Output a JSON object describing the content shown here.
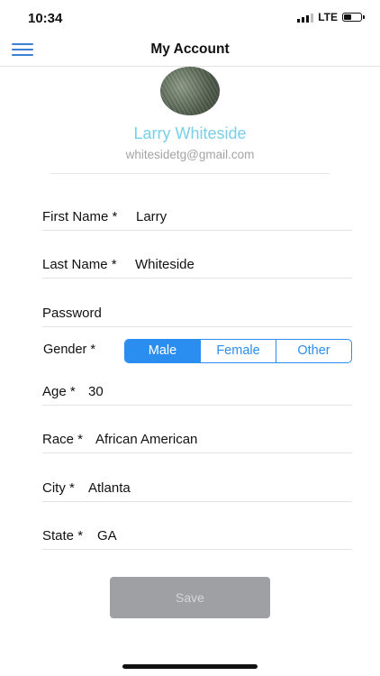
{
  "status_bar": {
    "time": "10:34",
    "network": "LTE"
  },
  "header": {
    "title": "My Account"
  },
  "profile": {
    "name": "Larry Whiteside",
    "email": "whitesidetg@gmail.com"
  },
  "fields": {
    "first_name": {
      "label": "First Name *",
      "value": "Larry"
    },
    "last_name": {
      "label": "Last Name *",
      "value": "Whiteside"
    },
    "password": {
      "label": "Password",
      "value": ""
    },
    "age": {
      "label": "Age *",
      "value": "30"
    },
    "race": {
      "label": "Race *",
      "value": "African American"
    },
    "city": {
      "label": "City *",
      "value": "Atlanta"
    },
    "state": {
      "label": "State *",
      "value": "GA"
    }
  },
  "gender": {
    "label": "Gender *",
    "options": [
      "Male",
      "Female",
      "Other"
    ],
    "selected": "Male"
  },
  "save_label": "Save",
  "colors": {
    "accent": "#2a8ef0",
    "name": "#79cfe8",
    "save_bg": "#9ea0a3"
  }
}
